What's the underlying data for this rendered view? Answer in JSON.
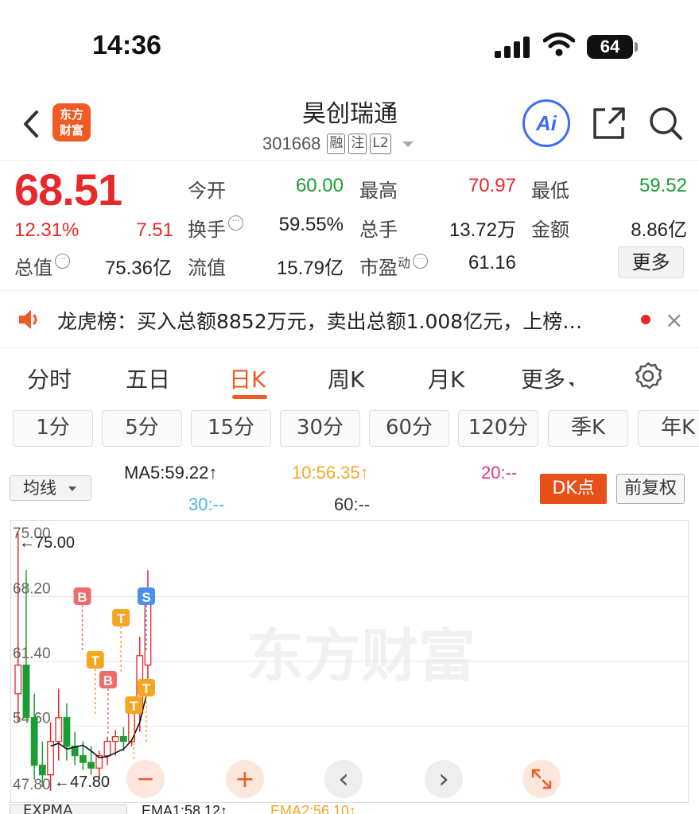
{
  "status_bar": {
    "time": "14:36",
    "battery": "64"
  },
  "header": {
    "logo_line1": "东方",
    "logo_line2": "财富",
    "stock_name": "昊创瑞通",
    "stock_code": "301668",
    "tags": [
      "融",
      "注",
      "L2"
    ],
    "ai_label": "Ai"
  },
  "quote": {
    "price": "68.51",
    "change_pct": "12.31%",
    "change": "7.51",
    "open_label": "今开",
    "open": "60.00",
    "high_label": "最高",
    "high": "70.97",
    "low_label": "最低",
    "low": "59.52",
    "turnover_label": "换手",
    "turnover": "59.55%",
    "volume_label": "总手",
    "volume": "13.72万",
    "amount_label": "金额",
    "amount": "8.86亿",
    "mcap_label": "总值",
    "mcap": "75.36亿",
    "float_label": "流值",
    "float_mcap": "15.79亿",
    "pe_label": "市盈",
    "pe_sup": "动",
    "pe": "61.16",
    "more": "更多",
    "colors": {
      "up": "#e8292a",
      "down": "#1a9e33"
    }
  },
  "news": {
    "text": "龙虎榜：买入总额8852万元，卖出总额1.008亿元，上榜…",
    "close": "×"
  },
  "tabs": [
    "分时",
    "五日",
    "日K",
    "周K",
    "月K",
    "更多"
  ],
  "active_tab": "日K",
  "periods": [
    "1分",
    "5分",
    "15分",
    "30分",
    "60分",
    "120分",
    "季K",
    "年K"
  ],
  "ma": {
    "select": "均线",
    "ma5": "MA5:59.22↑",
    "ma10": "10:56.35↑",
    "ma20": "20:--",
    "ma30": "30:--",
    "ma60": "60:--",
    "dk_button": "DK点",
    "fq_button": "前复权"
  },
  "chart_data": {
    "type": "candlestick",
    "y_ticks": [
      "75.00",
      "68.20",
      "61.40",
      "54.60",
      "47.80"
    ],
    "ylim": [
      47.8,
      75.0
    ],
    "high_marker": "←75.00",
    "low_marker": "←47.80",
    "watermark": "东方财富",
    "candles": [
      {
        "o": 58.0,
        "h": 75.0,
        "l": 55.0,
        "c": 61.0
      },
      {
        "o": 61.0,
        "h": 71.0,
        "l": 57.0,
        "c": 55.5
      },
      {
        "o": 55.5,
        "h": 58.0,
        "l": 49.0,
        "c": 50.5
      },
      {
        "o": 50.5,
        "h": 53.0,
        "l": 48.2,
        "c": 49.5
      },
      {
        "o": 49.5,
        "h": 55.0,
        "l": 47.8,
        "c": 53.0
      },
      {
        "o": 53.0,
        "h": 58.5,
        "l": 51.0,
        "c": 55.5
      },
      {
        "o": 55.5,
        "h": 57.0,
        "l": 51.0,
        "c": 52.5
      },
      {
        "o": 52.5,
        "h": 54.0,
        "l": 50.5,
        "c": 51.5
      },
      {
        "o": 51.5,
        "h": 53.0,
        "l": 50.0,
        "c": 50.8
      },
      {
        "o": 50.8,
        "h": 52.5,
        "l": 49.5,
        "c": 50.2
      },
      {
        "o": 50.2,
        "h": 52.0,
        "l": 49.0,
        "c": 51.5
      },
      {
        "o": 51.5,
        "h": 53.5,
        "l": 50.5,
        "c": 53.0
      },
      {
        "o": 53.0,
        "h": 54.2,
        "l": 51.5,
        "c": 53.5
      },
      {
        "o": 53.5,
        "h": 54.5,
        "l": 52.0,
        "c": 53.0
      },
      {
        "o": 53.0,
        "h": 56.5,
        "l": 52.5,
        "c": 56.0
      },
      {
        "o": 56.0,
        "h": 64.0,
        "l": 54.0,
        "c": 62.0
      },
      {
        "o": 61.0,
        "h": 70.97,
        "l": 59.52,
        "c": 68.51
      }
    ],
    "ma5_line": [
      null,
      null,
      null,
      null,
      52.5,
      52.8,
      52.2,
      52.4,
      52.6,
      52.0,
      51.3,
      51.4,
      51.8,
      52.2,
      53.1,
      55.0,
      58.5
    ],
    "signals": [
      {
        "label": "B",
        "kind": "buy",
        "index": 4
      },
      {
        "label": "T",
        "kind": "t",
        "index": 5
      },
      {
        "label": "B",
        "kind": "buy",
        "index": 6
      },
      {
        "label": "T",
        "kind": "t",
        "index": 7
      },
      {
        "label": "T",
        "kind": "t",
        "index": 8
      },
      {
        "label": "T",
        "kind": "t",
        "index": 9
      },
      {
        "label": "S",
        "kind": "sell",
        "index": 12
      }
    ],
    "grid": true
  },
  "chart_controls": {
    "zoom_out": "−",
    "zoom_in": "+",
    "prev": "‹",
    "next": "›"
  },
  "bottom": {
    "select": "EXPMA",
    "ema1": "EMA1:58.12↑",
    "ema2": "EMA2:56.10↑"
  }
}
